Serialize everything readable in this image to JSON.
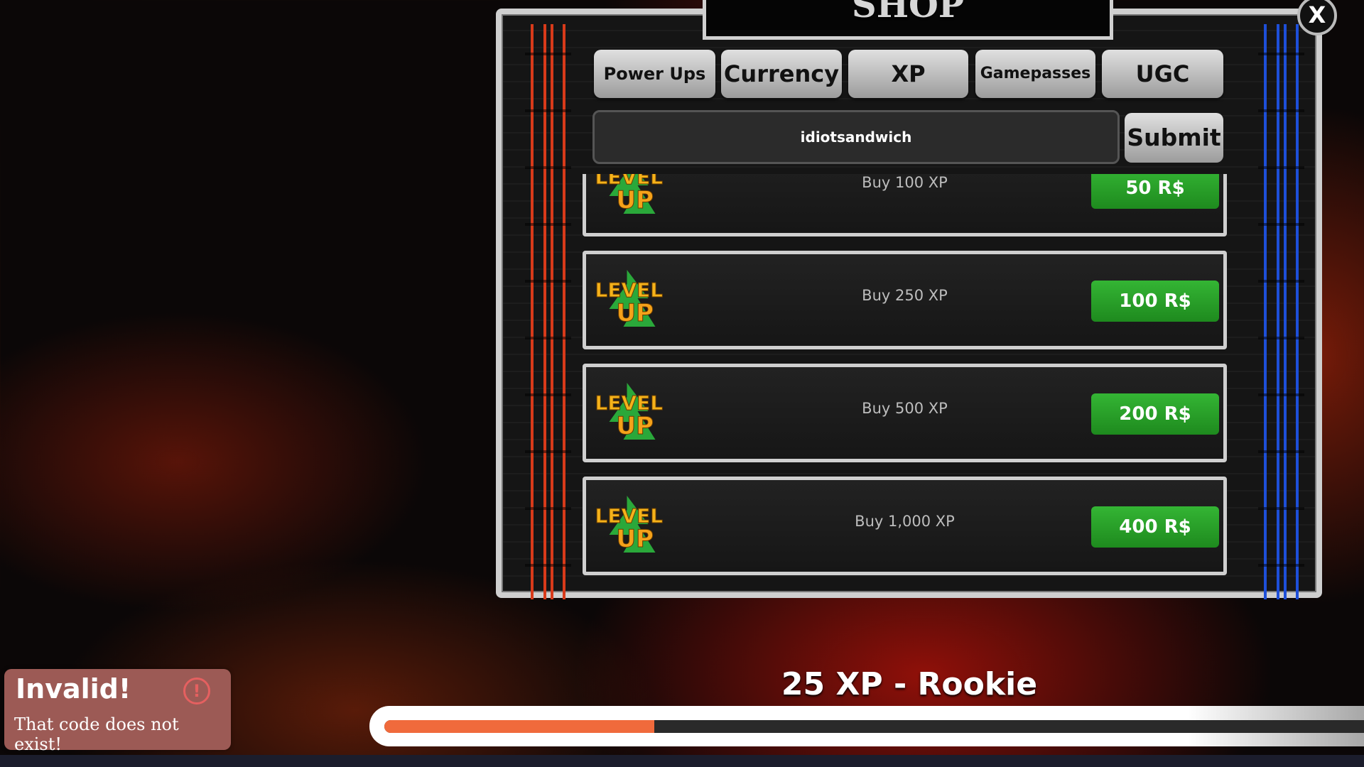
{
  "shop": {
    "title": "SHOP",
    "close_label": "X",
    "tabs": [
      {
        "label": "Power Ups"
      },
      {
        "label": "Currency"
      },
      {
        "label": "XP"
      },
      {
        "label": "Gamepasses"
      },
      {
        "label": "UGC"
      }
    ],
    "code_input": {
      "value": "idiotsandwich"
    },
    "submit_label": "Submit",
    "items": [
      {
        "label": "Buy 100 XP",
        "price": "50 R$",
        "icon": "level-up-icon"
      },
      {
        "label": "Buy 250 XP",
        "price": "100 R$",
        "icon": "level-up-icon"
      },
      {
        "label": "Buy 500 XP",
        "price": "200 R$",
        "icon": "level-up-icon"
      },
      {
        "label": "Buy 1,000 XP",
        "price": "400 R$",
        "icon": "level-up-icon"
      }
    ],
    "accent_colors": {
      "price": "#2ea52e",
      "left_pillar": "#d83a1a",
      "right_pillar": "#1e4fd8"
    }
  },
  "toast": {
    "title": "Invalid!",
    "message": "That code does not exist!",
    "icon": "alert-icon"
  },
  "xp": {
    "label": "25 XP - Rookie",
    "progress": 0.25,
    "fill_color": "#f06a3c"
  }
}
